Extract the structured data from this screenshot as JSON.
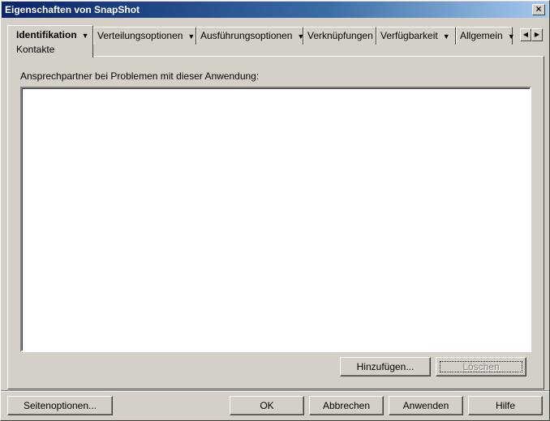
{
  "window": {
    "title": "Eigenschaften von SnapShot",
    "close_glyph": "×"
  },
  "tabs": [
    {
      "label": "Identifikation",
      "sub": "Kontakte",
      "has_dropdown": true,
      "active": true
    },
    {
      "label": "Verteilungsoptionen",
      "has_dropdown": true
    },
    {
      "label": "Ausführungsoptionen",
      "has_dropdown": true
    },
    {
      "label": "Verknüpfungen",
      "has_dropdown": false
    },
    {
      "label": "Verfügbarkeit",
      "has_dropdown": true
    },
    {
      "label": "Allgemein",
      "has_dropdown": true
    }
  ],
  "tab_scroll": {
    "left": "◀",
    "right": "▶"
  },
  "contacts": {
    "label": "Ansprechpartner bei Problemen mit dieser Anwendung:",
    "items": []
  },
  "buttons": {
    "add": "Hinzufügen...",
    "delete": "Löschen",
    "page_options": "Seitenoptionen...",
    "ok": "OK",
    "cancel": "Abbrechen",
    "apply": "Anwenden",
    "help": "Hilfe"
  },
  "colors": {
    "face": "#d4d0c8",
    "titlebar_start": "#0a246a",
    "titlebar_end": "#a6caf0"
  }
}
